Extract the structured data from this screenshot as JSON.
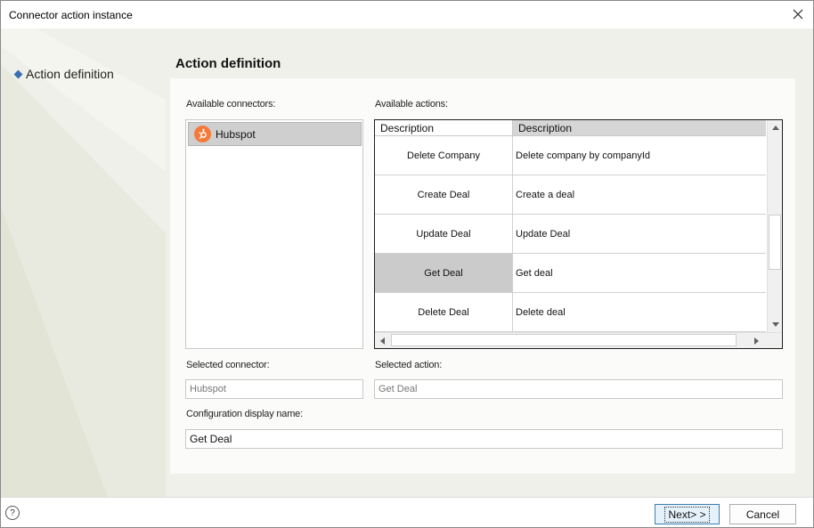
{
  "window": {
    "title": "Connector action instance"
  },
  "nav": {
    "items": [
      {
        "label": "Action definition"
      }
    ]
  },
  "page": {
    "heading": "Action definition"
  },
  "connectors": {
    "label": "Available connectors:",
    "items": [
      {
        "name": "Hubspot",
        "icon": "hubspot-icon",
        "selected": true
      }
    ]
  },
  "actions": {
    "label": "Available actions:",
    "columns": [
      "Description",
      "Description"
    ],
    "rows": [
      {
        "name": "Delete Company",
        "description": "Delete company by companyId",
        "selected": false
      },
      {
        "name": "Create Deal",
        "description": "Create a deal",
        "selected": false
      },
      {
        "name": "Update Deal",
        "description": "Update Deal",
        "selected": false
      },
      {
        "name": "Get Deal",
        "description": "Get deal",
        "selected": true
      },
      {
        "name": "Delete Deal",
        "description": "Delete deal",
        "selected": false
      }
    ]
  },
  "selected_connector": {
    "label": "Selected connector:",
    "value": "Hubspot"
  },
  "selected_action": {
    "label": "Selected action:",
    "value": "Get Deal"
  },
  "config_name": {
    "label": "Configuration display name:",
    "value": "Get Deal"
  },
  "footer": {
    "help": "?",
    "next_label": "Next> >",
    "cancel_label": "Cancel"
  },
  "colors": {
    "accent": "#3a6fb5",
    "brand_hubspot": "#f57a3a",
    "selection": "#cbcbcb"
  }
}
